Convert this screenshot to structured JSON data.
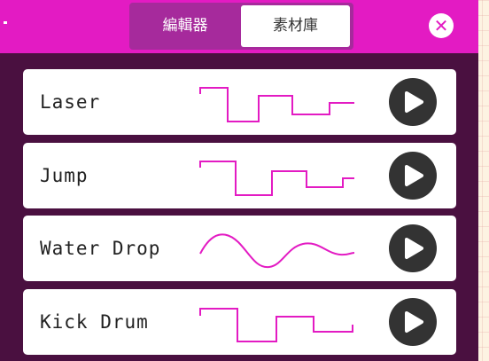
{
  "tabs": {
    "editor_label": "編輯器",
    "assets_label": "素材庫",
    "active": "editor"
  },
  "icons": {
    "close": "close-icon",
    "play": "play-icon"
  },
  "colors": {
    "accent": "#e31bc3",
    "panel": "#4a1040",
    "wave": "#e31bc3",
    "play_button": "#333333"
  },
  "sounds": [
    {
      "name": "Laser",
      "waveform": "square-descending"
    },
    {
      "name": "Jump",
      "waveform": "square-ascending"
    },
    {
      "name": "Water Drop",
      "waveform": "sine-decaying"
    },
    {
      "name": "Kick Drum",
      "waveform": "square-pulse"
    }
  ]
}
